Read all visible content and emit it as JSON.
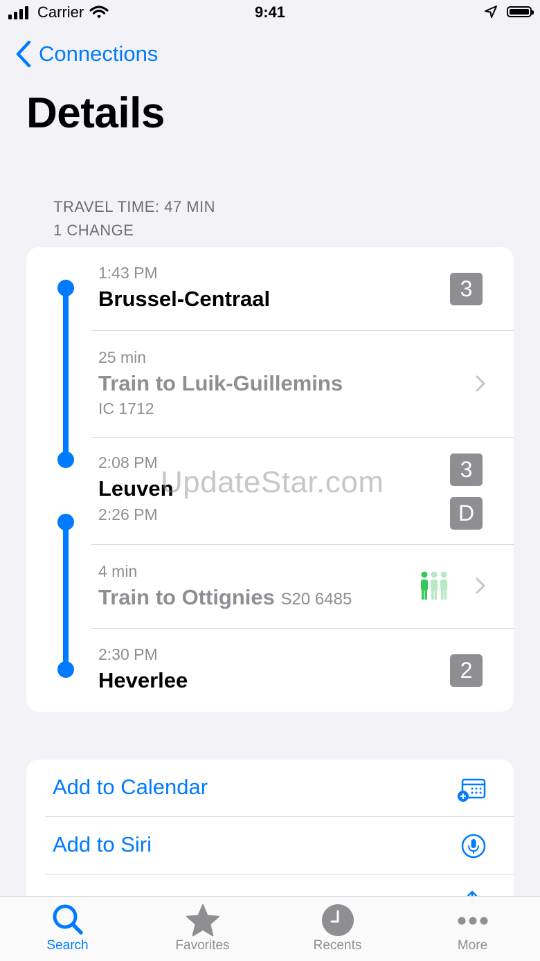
{
  "status_bar": {
    "carrier": "Carrier",
    "time": "9:41"
  },
  "nav": {
    "back_label": "Connections",
    "title": "Details"
  },
  "summary": {
    "travel_time": "TRAVEL TIME: 47 MIN",
    "changes": "1 CHANGE"
  },
  "journey": {
    "departure": {
      "time": "1:43 PM",
      "station": "Brussel-Centraal",
      "platform": "3"
    },
    "leg1": {
      "duration": "25 min",
      "title": "Train to Luik-Guillemins",
      "train": "IC 1712"
    },
    "transfer": {
      "arrival_time": "2:08 PM",
      "station": "Leuven",
      "departure_time": "2:26 PM",
      "arrival_platform": "3",
      "departure_platform": "D"
    },
    "leg2": {
      "duration": "4 min",
      "title": "Train to Ottignies",
      "train": "S20 6485"
    },
    "arrival": {
      "time": "2:30 PM",
      "station": "Heverlee",
      "platform": "2"
    }
  },
  "actions": {
    "calendar_label": "Add to Calendar",
    "siri_label": "Add to Siri"
  },
  "watermark": "UpdateStar.com",
  "tabs": [
    {
      "label": "Search"
    },
    {
      "label": "Favorites"
    },
    {
      "label": "Recents"
    },
    {
      "label": "More"
    }
  ],
  "colors": {
    "accent": "#007aff",
    "occupancy_full": "#34c759",
    "occupancy_empty": "#b7e9c4",
    "platform_badge": "#8e8e93"
  },
  "icons": [
    "signal-icon",
    "wifi-icon",
    "location-arrow-icon",
    "battery-icon",
    "chevron-left-icon",
    "chevron-right-icon",
    "occupancy-icon",
    "calendar-add-icon",
    "microphone-icon",
    "share-icon",
    "search-icon",
    "star-icon",
    "clock-icon",
    "more-dots-icon"
  ]
}
